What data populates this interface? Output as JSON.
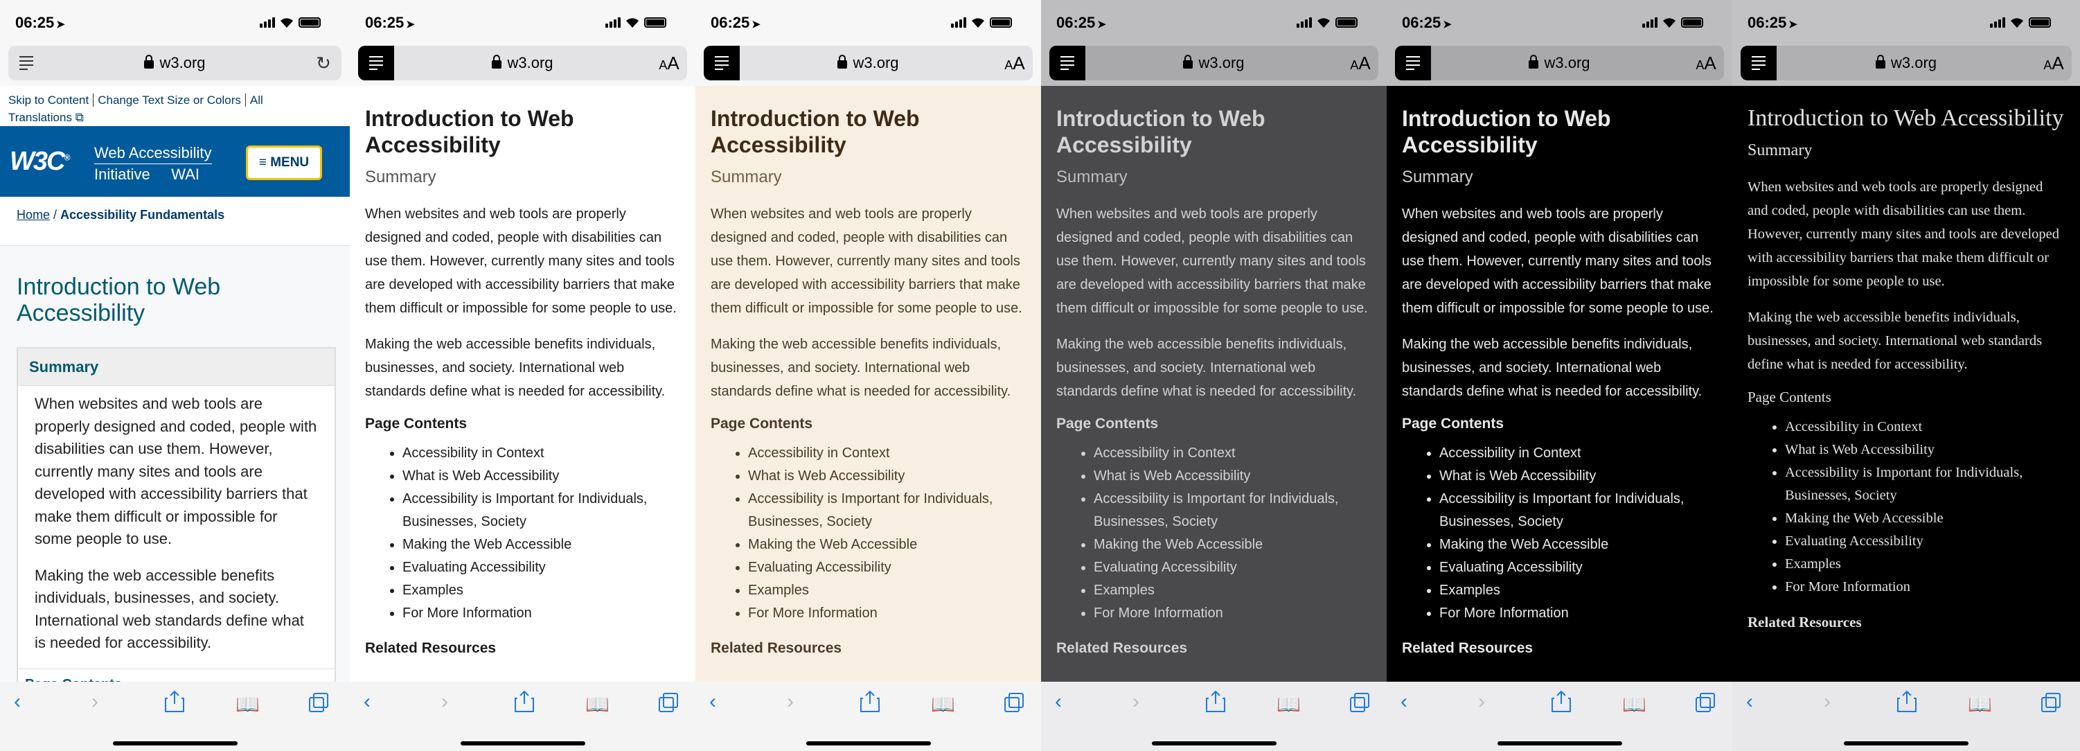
{
  "status": {
    "time": "06:25"
  },
  "address": {
    "domain": "w3.org",
    "text_size_small": "A",
    "text_size_large": "A"
  },
  "original_page": {
    "skip_link": "Skip to Content",
    "text_size_link": "Change Text Size or Colors",
    "translations_link": "All",
    "translations_link_2": "Translations",
    "logo": "W3C",
    "logo_reg": "®",
    "site_title_line1": "Web Accessibility",
    "site_title_line2a": "Initiative",
    "site_title_line2b": "WAI",
    "menu_button": "MENU",
    "breadcrumb_home": "Home",
    "breadcrumb_sep": " / ",
    "breadcrumb_current": "Accessibility Fundamentals",
    "heading": "Introduction to Web Accessibility",
    "summary_title": "Summary",
    "summary_p1": "When websites and web tools are properly designed and coded, people with disabilities can use them. However, currently many sites and tools are developed with accessibility barriers that make them difficult or impossible for some people to use.",
    "summary_p2": "Making the web accessible benefits individuals, businesses, and society. International web standards define what is needed for accessibility.",
    "page_contents_cut": "Page Contents"
  },
  "reader": {
    "title": "Introduction to Web Accessibility",
    "subtitle": "Summary",
    "p1": "When websites and web tools are properly designed and coded, people with disabilities can use them. However, currently many sites and tools are developed with accessibility barriers that make them difficult or impossible for some people to use.",
    "p2": "Making the web accessible benefits individuals, businesses, and society. International web standards define what is needed for accessibility.",
    "contents_heading": "Page Contents",
    "contents": [
      "Accessibility in Context",
      "What is Web Accessibility",
      "Accessibility is Important for Individuals, Businesses, Society",
      "Making the Web Accessible",
      "Evaluating Accessibility",
      "Examples",
      "For More Information"
    ],
    "related_cut": "Related Resources"
  },
  "themes": [
    "original",
    "white",
    "sepia",
    "gray",
    "black",
    "black-serif"
  ],
  "colors": {
    "wai_blue": "#005a9c",
    "menu_border": "#f2c500",
    "sepia_bg": "#f8efe2",
    "gray_bg": "#4a4a4c",
    "safari_blue": "#1f7ae0"
  }
}
